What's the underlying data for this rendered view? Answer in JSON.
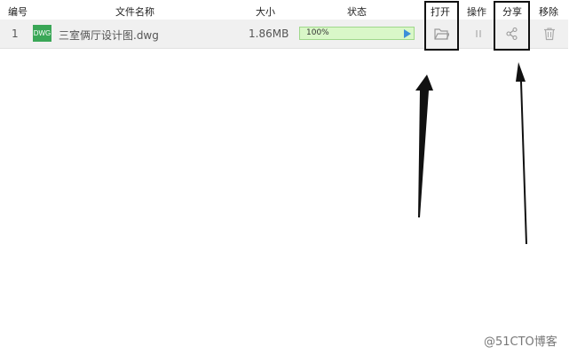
{
  "header": {
    "col_num": "编号",
    "col_name": "文件名称",
    "col_size": "大小",
    "col_status": "状态",
    "col_open": "打开",
    "col_ops": "操作",
    "col_share": "分享",
    "col_remove": "移除"
  },
  "rows": [
    {
      "num": "1",
      "file_type": "DWG",
      "name": "三室俩厅设计图.dwg",
      "size": "1.86MB",
      "progress_label": "100%",
      "progress": 1.0
    }
  ],
  "icons": {
    "file": "dwg-file-icon",
    "play": "play-icon",
    "open": "folder-open-icon",
    "pause": "pause-icon",
    "share": "share-icon",
    "remove": "trash-icon"
  },
  "colors": {
    "file_icon": "#3aa757",
    "progress_fill": "#d9f7c8",
    "progress_border": "#9fd88b",
    "play": "#3b8fd9"
  },
  "watermark": "@51CTO博客"
}
